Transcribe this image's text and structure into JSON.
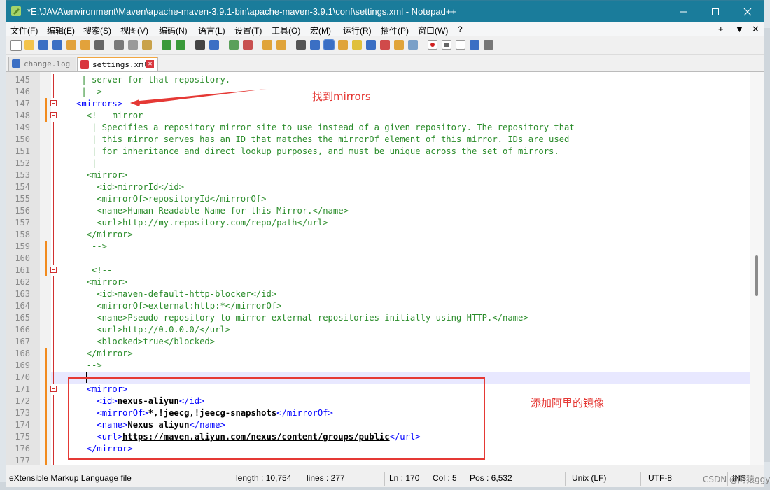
{
  "window": {
    "title": "*E:\\JAVA\\environment\\Maven\\apache-maven-3.9.1-bin\\apache-maven-3.9.1\\conf\\settings.xml - Notepad++",
    "titlebar_color": "#1a7c9b"
  },
  "menu": {
    "items": [
      "文件(F)",
      "编辑(E)",
      "搜索(S)",
      "视图(V)",
      "编码(N)",
      "语言(L)",
      "设置(T)",
      "工具(O)",
      "宏(M)",
      "运行(R)",
      "插件(P)",
      "窗口(W)",
      "?"
    ],
    "right": [
      "+",
      "▼",
      "✕"
    ]
  },
  "tabs": [
    {
      "label": "change.log",
      "active": false
    },
    {
      "label": "settings.xml",
      "active": true
    }
  ],
  "editor": {
    "lines": [
      {
        "n": "145",
        "text": " | server for that repository."
      },
      {
        "n": "146",
        "text": " |-->"
      },
      {
        "n": "147",
        "text": "<mirrors>"
      },
      {
        "n": "148",
        "text": "  <!-- mirror"
      },
      {
        "n": "149",
        "text": "   | Specifies a repository mirror site to use instead of a given repository. The repository that"
      },
      {
        "n": "150",
        "text": "   | this mirror serves has an ID that matches the mirrorOf element of this mirror. IDs are used"
      },
      {
        "n": "151",
        "text": "   | for inheritance and direct lookup purposes, and must be unique across the set of mirrors."
      },
      {
        "n": "152",
        "text": "   |"
      },
      {
        "n": "153",
        "text": "  <mirror>"
      },
      {
        "n": "154",
        "text": "    <id>mirrorId</id>"
      },
      {
        "n": "155",
        "text": "    <mirrorOf>repositoryId</mirrorOf>"
      },
      {
        "n": "156",
        "text": "    <name>Human Readable Name for this Mirror.</name>"
      },
      {
        "n": "157",
        "text": "    <url>http://my.repository.com/repo/path</url>"
      },
      {
        "n": "158",
        "text": "  </mirror>"
      },
      {
        "n": "159",
        "text": "   -->"
      },
      {
        "n": "160",
        "text": ""
      },
      {
        "n": "161",
        "text": "   <!--"
      },
      {
        "n": "162",
        "text": "  <mirror>"
      },
      {
        "n": "163",
        "text": "    <id>maven-default-http-blocker</id>"
      },
      {
        "n": "164",
        "text": "    <mirrorOf>external:http:*</mirrorOf>"
      },
      {
        "n": "165",
        "text": "    <name>Pseudo repository to mirror external repositories initially using HTTP.</name>"
      },
      {
        "n": "166",
        "text": "    <url>http://0.0.0.0/</url>"
      },
      {
        "n": "167",
        "text": "    <blocked>true</blocked>"
      },
      {
        "n": "168",
        "text": "  </mirror>"
      },
      {
        "n": "169",
        "text": "  -->"
      },
      {
        "n": "170",
        "text": ""
      },
      {
        "n": "171",
        "text": "  <mirror>"
      },
      {
        "n": "172",
        "text": "    <id>nexus-aliyun</id>"
      },
      {
        "n": "173",
        "text": "    <mirrorOf>*,!jeecg,!jeecg-snapshots</mirrorOf>"
      },
      {
        "n": "174",
        "text": "    <name>Nexus aliyun</name>"
      },
      {
        "n": "175",
        "text": "    <url>https://maven.aliyun.com/nexus/content/groups/public</url>"
      },
      {
        "n": "176",
        "text": "  </mirror>"
      },
      {
        "n": "177",
        "text": ""
      }
    ],
    "current_line": "170"
  },
  "annotations": {
    "find_mirrors": "找到mirrors",
    "add_aliyun": "添加阿里的镜像",
    "color": "#e53935"
  },
  "status": {
    "language": "eXtensible Markup Language file",
    "length": "length : 10,754",
    "lines": "lines : 277",
    "ln": "Ln : 170",
    "col": "Col : 5",
    "pos": "Pos : 6,532",
    "eol": "Unix (LF)",
    "encoding": "UTF-8",
    "mode": "INS"
  },
  "watermark": "CSDN @阿猿ggy"
}
